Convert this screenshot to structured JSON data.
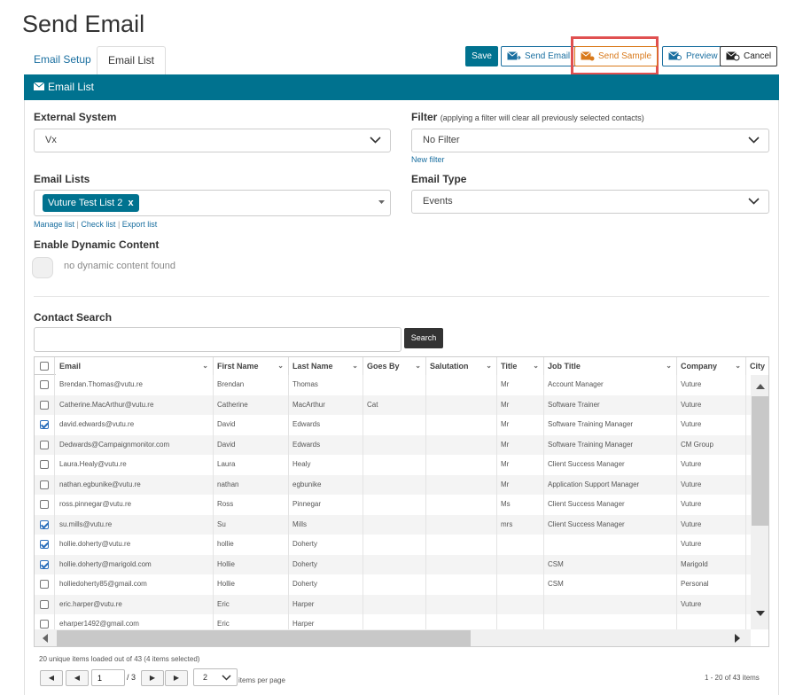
{
  "page_title": "Send Email",
  "tabs": [
    {
      "label": "Email Setup"
    },
    {
      "label": "Email List"
    }
  ],
  "toolbar": {
    "save": "Save",
    "send_email": "Send Email",
    "send_sample": "Send Sample",
    "preview": "Preview",
    "cancel": "Cancel"
  },
  "panel_title": "Email List",
  "form": {
    "external_system": {
      "label": "External System",
      "value": "Vx"
    },
    "filter": {
      "label": "Filter",
      "note": "(applying a filter will clear all previously selected contacts)",
      "value": "No Filter",
      "link": "New filter"
    },
    "email_lists": {
      "label": "Email Lists",
      "tag": "Vuture Test List 2",
      "links": [
        "Manage list",
        "Check list",
        "Export list"
      ],
      "sep": "|"
    },
    "email_type": {
      "label": "Email Type",
      "value": "Events"
    },
    "dynamic": {
      "label": "Enable Dynamic Content",
      "text": "no dynamic content found"
    },
    "contact_search": {
      "label": "Contact Search",
      "button": "Search",
      "value": ""
    }
  },
  "grid": {
    "columns": [
      "Email",
      "First Name",
      "Last Name",
      "Goes By",
      "Salutation",
      "Title",
      "Job Title",
      "Company",
      "City"
    ],
    "rows": [
      {
        "checked": false,
        "cells": [
          "Brendan.Thomas@vutu.re",
          "Brendan",
          "Thomas",
          "",
          "",
          "Mr",
          "Account Manager",
          "Vuture"
        ]
      },
      {
        "checked": false,
        "cells": [
          "Catherine.MacArthur@vutu.re",
          "Catherine",
          "MacArthur",
          "Cat",
          "",
          "Mr",
          "Software Trainer",
          "Vuture"
        ]
      },
      {
        "checked": true,
        "cells": [
          "david.edwards@vutu.re",
          "David",
          "Edwards",
          "",
          "",
          "Mr",
          "Software Training Manager",
          "Vuture"
        ]
      },
      {
        "checked": false,
        "cells": [
          "Dedwards@Campaignmonitor.com",
          "David",
          "Edwards",
          "",
          "",
          "Mr",
          "Software Training Manager",
          "CM Group"
        ]
      },
      {
        "checked": false,
        "cells": [
          "Laura.Healy@vutu.re",
          "Laura",
          "Healy",
          "",
          "",
          "Mr",
          "Client Success Manager",
          "Vuture"
        ]
      },
      {
        "checked": false,
        "cells": [
          "nathan.egbunike@vutu.re",
          "nathan",
          "egbunike",
          "",
          "",
          "Mr",
          "Application Support Manager",
          "Vuture"
        ]
      },
      {
        "checked": false,
        "cells": [
          "ross.pinnegar@vutu.re",
          "Ross",
          "Pinnegar",
          "",
          "",
          "Ms",
          "Client Success Manager",
          "Vuture"
        ]
      },
      {
        "checked": true,
        "cells": [
          "su.mills@vutu.re",
          "Su",
          "Mills",
          "",
          "",
          "mrs",
          "Client Success Manager",
          "Vuture"
        ]
      },
      {
        "checked": true,
        "cells": [
          "hollie.doherty@vutu.re",
          "hollie",
          "Doherty",
          "",
          "",
          "",
          "",
          "Vuture"
        ]
      },
      {
        "checked": true,
        "cells": [
          "hollie.doherty@marigold.com",
          "Hollie",
          "Doherty",
          "",
          "",
          "",
          "CSM",
          "Marigold"
        ]
      },
      {
        "checked": false,
        "cells": [
          "holliedoherty85@gmail.com",
          "Hollie",
          "Doherty",
          "",
          "",
          "",
          "CSM",
          "Personal"
        ]
      },
      {
        "checked": false,
        "cells": [
          "eric.harper@vutu.re",
          "Eric",
          "Harper",
          "",
          "",
          "",
          "",
          "Vuture"
        ]
      },
      {
        "checked": false,
        "cells": [
          "eharper1492@gmail.com",
          "Eric",
          "Harper",
          "",
          "",
          "",
          "",
          ""
        ]
      }
    ]
  },
  "footer": {
    "summary": "20 unique items loaded out of 43 (4 items selected)",
    "page": "1",
    "of_pages": "/ 3",
    "page_size": "2",
    "per_page": "items per page",
    "range": "1 - 20 of 43 items"
  },
  "colors": {
    "accent": "#00728f",
    "highlight": "#e05050",
    "sample": "#d97a1c"
  }
}
